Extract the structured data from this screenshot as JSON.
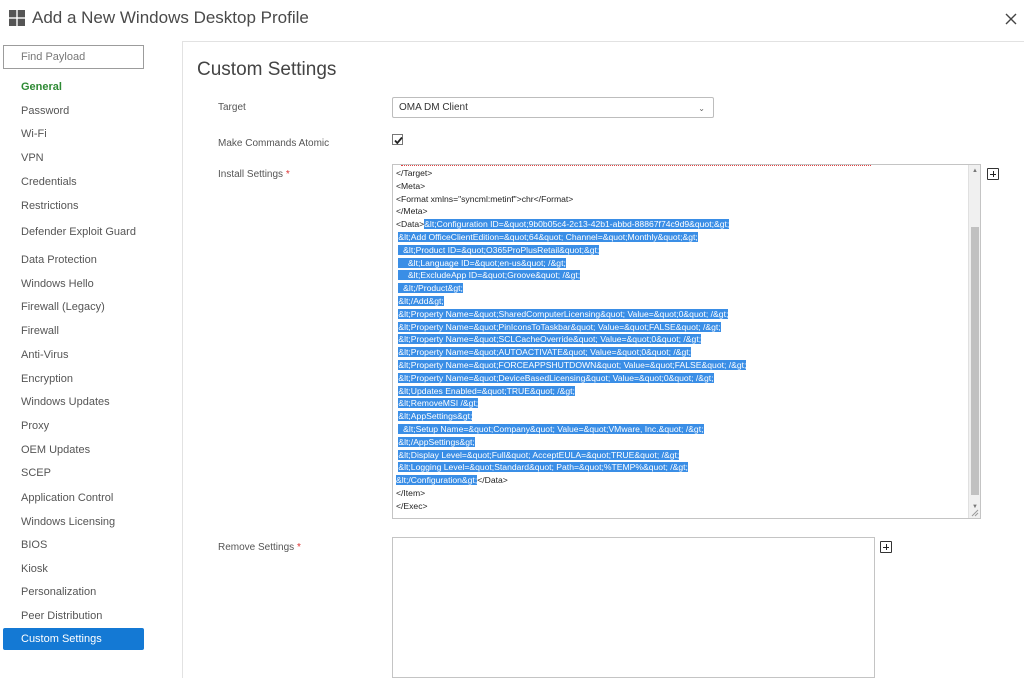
{
  "window": {
    "title": "Add a New Windows Desktop Profile",
    "logo_icon": "windows-logo-icon",
    "close_icon": "close-icon"
  },
  "sidebar": {
    "search_placeholder": "Find Payload",
    "items": [
      {
        "label": "General"
      },
      {
        "label": "Password"
      },
      {
        "label": "Wi-Fi"
      },
      {
        "label": "VPN"
      },
      {
        "label": "Credentials"
      },
      {
        "label": "Restrictions"
      },
      {
        "label": "Defender Exploit Guard"
      },
      {
        "label": "Data Protection"
      },
      {
        "label": "Windows Hello"
      },
      {
        "label": "Firewall (Legacy)"
      },
      {
        "label": "Firewall"
      },
      {
        "label": "Anti-Virus"
      },
      {
        "label": "Encryption"
      },
      {
        "label": "Windows Updates"
      },
      {
        "label": "Proxy"
      },
      {
        "label": "OEM Updates"
      },
      {
        "label": "SCEP"
      },
      {
        "label": "Application Control"
      },
      {
        "label": "Windows Licensing"
      },
      {
        "label": "BIOS"
      },
      {
        "label": "Kiosk"
      },
      {
        "label": "Personalization"
      },
      {
        "label": "Peer Distribution"
      },
      {
        "label": "Custom Settings"
      }
    ],
    "active_item": "Custom Settings",
    "active_color": "#1479d4",
    "general_color": "#2e8a34"
  },
  "main": {
    "heading": "Custom Settings",
    "target": {
      "label": "Target",
      "value": "OMA DM Client"
    },
    "atomic": {
      "label": "Make Commands Atomic",
      "checked": true
    },
    "install": {
      "label": "Install Settings",
      "required_mark": "*",
      "lines": [
        "</Target>",
        "<Meta>",
        "<Format xmlns=\"syncml:metinf\">chr</Format>",
        "</Meta>",
        "&lt;Configuration ID=&quot;9b0b05c4-2c13-42b1-abbd-88867f74c9d9&quot;&gt;",
        "&lt;Add OfficeClientEdition=&quot;64&quot; Channel=&quot;Monthly&quot;&gt;",
        "&lt;Product ID=&quot;O365ProPlusRetail&quot;&gt;",
        "&lt;Language ID=&quot;en-us&quot; /&gt;",
        "&lt;ExcludeApp ID=&quot;Groove&quot; /&gt;",
        "&lt;/Product&gt;",
        "&lt;/Add&gt;",
        "&lt;Property Name=&quot;SharedComputerLicensing&quot; Value=&quot;0&quot; /&gt;",
        "&lt;Property Name=&quot;PinIconsToTaskbar&quot; Value=&quot;FALSE&quot; /&gt;",
        "&lt;Property Name=&quot;SCLCacheOverride&quot; Value=&quot;0&quot; /&gt;",
        "&lt;Property Name=&quot;AUTOACTIVATE&quot; Value=&quot;0&quot; /&gt;",
        "&lt;Property Name=&quot;FORCEAPPSHUTDOWN&quot; Value=&quot;FALSE&quot; /&gt;",
        "&lt;Property Name=&quot;DeviceBasedLicensing&quot; Value=&quot;0&quot; /&gt;",
        "&lt;Updates Enabled=&quot;TRUE&quot; /&gt;",
        "&lt;RemoveMSI /&gt;",
        "&lt;AppSettings&gt;",
        "&lt;Setup Name=&quot;Company&quot; Value=&quot;VMware, Inc.&quot; /&gt;",
        "&lt;/AppSettings&gt;",
        "&lt;Display Level=&quot;Full&quot; AcceptEULA=&quot;TRUE&quot; /&gt;",
        "&lt;Logging Level=&quot;Standard&quot; Path=&quot;%TEMP%&quot; /&gt;",
        "&lt;/Configuration&gt;",
        "</Item>",
        "</Exec>"
      ],
      "data_open_tag": "<Data>",
      "data_close_tag": "</Data>"
    },
    "remove": {
      "label": "Remove Settings",
      "required_mark": "*"
    },
    "selection_color": "#3a8ee6"
  }
}
